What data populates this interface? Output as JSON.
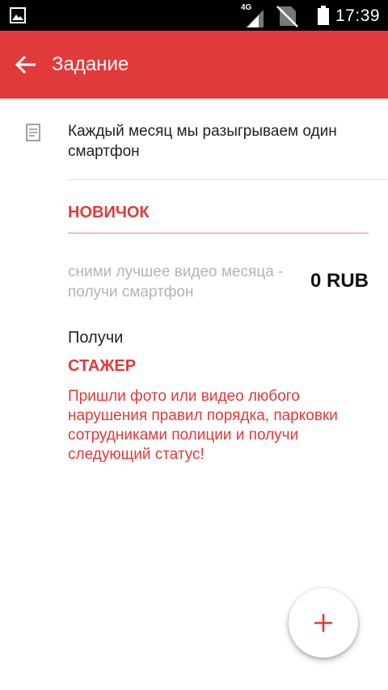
{
  "status_bar": {
    "network_label": "4G",
    "time": "17:39",
    "icons": [
      "image-icon",
      "signal-icon",
      "no-sim-icon",
      "battery-icon"
    ]
  },
  "app_bar": {
    "title": "Задание",
    "back_icon": "arrow-back-icon",
    "color": "#e13a3a"
  },
  "task": {
    "icon": "document-icon",
    "description": "Каждый месяц мы разыгрываем один смартфон"
  },
  "current_level": {
    "title": "НОВИЧОК",
    "goal": "сними лучшее видео месяца - получи смартфон",
    "reward": "0 RUB"
  },
  "next": {
    "label": "Получи",
    "level_title": "СТАЖЕР",
    "description": "Пришли фото или видео любого нарушения правил порядка, парковки сотрудниками полиции и получи следующий статус!"
  },
  "fab": {
    "icon": "plus-icon",
    "color": "#e13a3a"
  }
}
